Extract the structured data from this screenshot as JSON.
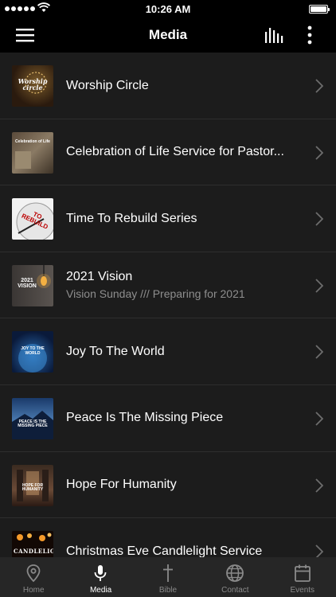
{
  "status_bar": {
    "time": "10:26 AM",
    "signal_dots": 5,
    "battery_level": 1.0
  },
  "header": {
    "title": "Media",
    "menu_icon": "hamburger-icon",
    "equalizer_icon": "equalizer-icon",
    "more_icon": "more-vertical-icon"
  },
  "media_items": [
    {
      "title": "Worship Circle",
      "subtitle": "",
      "thumb_text": "Worship circle"
    },
    {
      "title": "Celebration of Life Service for Pastor...",
      "subtitle": "",
      "thumb_text": "Celebration of Life"
    },
    {
      "title": "Time To Rebuild Series",
      "subtitle": "",
      "thumb_text": "TO REBUILD"
    },
    {
      "title": "2021 Vision",
      "subtitle": "Vision Sunday /// Preparing for 2021",
      "thumb_text": "2021 VISION"
    },
    {
      "title": "Joy To The World",
      "subtitle": "",
      "thumb_text": "JOY TO THE WORLD"
    },
    {
      "title": "Peace Is The Missing Piece",
      "subtitle": "",
      "thumb_text": "PEACE IS THE MISSING PIECE"
    },
    {
      "title": "Hope For Humanity",
      "subtitle": "",
      "thumb_text": "HOPE FOR HUMANITY"
    },
    {
      "title": "Christmas Eve Candlelight Service",
      "subtitle": "",
      "thumb_text": "CANDLELIG"
    }
  ],
  "tabs": [
    {
      "label": "Home",
      "icon": "map-pin-icon",
      "active": false
    },
    {
      "label": "Media",
      "icon": "microphone-icon",
      "active": true
    },
    {
      "label": "Bible",
      "icon": "cross-icon",
      "active": false
    },
    {
      "label": "Contact",
      "icon": "globe-icon",
      "active": false
    },
    {
      "label": "Events",
      "icon": "calendar-icon",
      "active": false
    }
  ]
}
